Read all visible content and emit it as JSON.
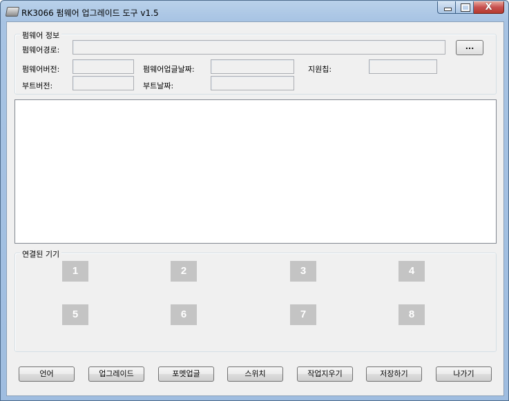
{
  "window": {
    "title": "RK3066 펌웨어 업그레이드 도구 v1.5",
    "close_glyph": "X"
  },
  "firmware_info": {
    "group_title": "펌웨어 정보",
    "path_label": "펌웨어경로:",
    "version_label": "펌웨어버전:",
    "date_label": "펌웨어업글날짜:",
    "support_label": "지원칩:",
    "boot_version_label": "부트버전:",
    "boot_date_label": "부트날짜:",
    "browse_label": "..."
  },
  "devices": {
    "group_title": "연결된 기기",
    "slots": [
      "1",
      "2",
      "3",
      "4",
      "5",
      "6",
      "7",
      "8"
    ]
  },
  "buttons": {
    "language": "언어",
    "upgrade": "업그레이드",
    "format": "포멧업글",
    "switch": "스위치",
    "clear": "작업지우기",
    "save": "저장하기",
    "exit": "나가기"
  },
  "colors": {
    "slot_fill": "#c4c4c4",
    "title_bar": "#b9d1ea",
    "close_button": "#c75050"
  }
}
